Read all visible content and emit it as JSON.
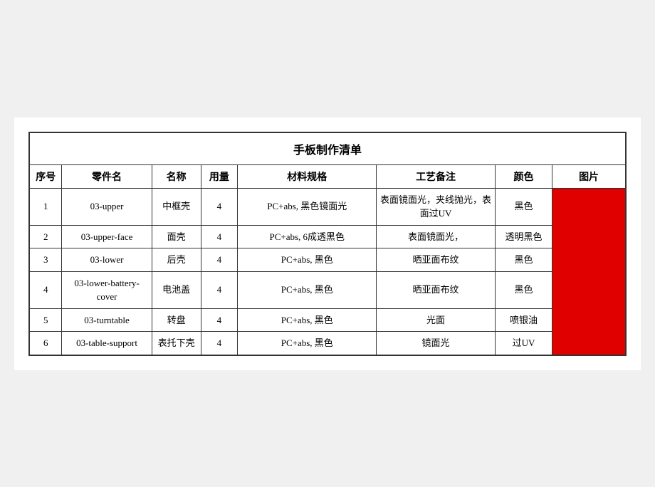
{
  "title": "手板制作清单",
  "headers": {
    "seq": "序号",
    "partname": "零件名",
    "name": "名称",
    "qty": "用量",
    "material": "材料规格",
    "process": "工艺备注",
    "color": "颜色",
    "image": "图片"
  },
  "rows": [
    {
      "seq": "1",
      "partname": "03-upper",
      "name": "中框壳",
      "qty": "4",
      "material": "PC+abs, 黑色镜面光",
      "process": "表面镜面光，夹线抛光，表面过UV",
      "color": "黑色"
    },
    {
      "seq": "2",
      "partname": "03-upper-face",
      "name": "面壳",
      "qty": "4",
      "material": "PC+abs, 6成透黑色",
      "process": "表面镜面光，",
      "color": "透明黑色"
    },
    {
      "seq": "3",
      "partname": "03-lower",
      "name": "后壳",
      "qty": "4",
      "material": "PC+abs, 黑色",
      "process": "晒亚面布纹",
      "color": "黑色"
    },
    {
      "seq": "4",
      "partname": "03-lower-battery-cover",
      "name": "电池盖",
      "qty": "4",
      "material": "PC+abs, 黑色",
      "process": "晒亚面布纹",
      "color": "黑色"
    },
    {
      "seq": "5",
      "partname": "03-turntable",
      "name": "转盘",
      "qty": "4",
      "material": "PC+abs, 黑色",
      "process": "光面",
      "color": "喷银油"
    },
    {
      "seq": "6",
      "partname": "03-table-support",
      "name": "表托下壳",
      "qty": "4",
      "material": "PC+abs, 黑色",
      "process": "镜面光",
      "color": "过UV"
    }
  ]
}
